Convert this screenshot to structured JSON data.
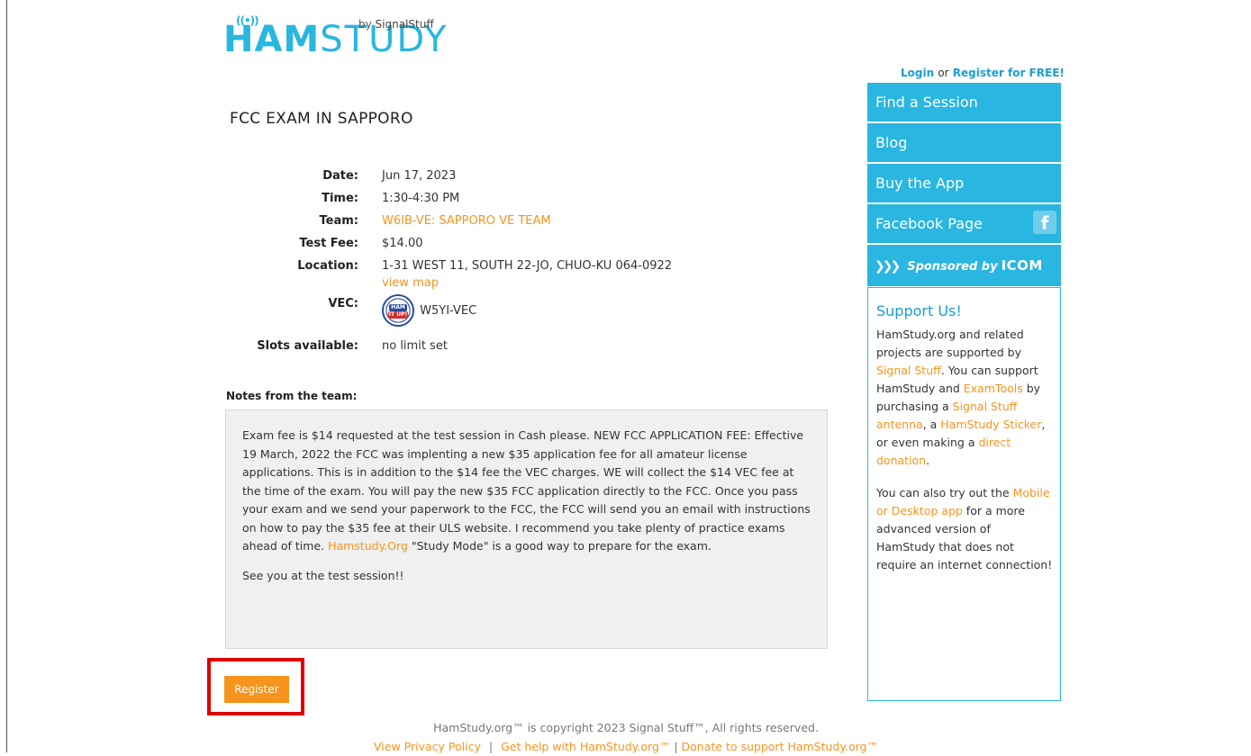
{
  "logo": {
    "ham": "HAM",
    "study": "STUDY",
    "waves": "((•))",
    "by": "by",
    "brand": "SignalStuff"
  },
  "title": "FCC EXAM IN SAPPORO",
  "details": {
    "date_label": "Date:",
    "date": "Jun 17, 2023",
    "time_label": "Time:",
    "time": "1:30-4:30 PM",
    "team_label": "Team:",
    "team": "W6IB-VE: SAPPORO VE TEAM",
    "fee_label": "Test Fee:",
    "fee": "$14.00",
    "location_label": "Location:",
    "location": "1-31 WEST 11, SOUTH 22-JO, CHUO-KU 064-0922",
    "view_map": "view map",
    "vec_label": "VEC:",
    "vec": "W5YI-VEC",
    "vec_logo_top": "HAM",
    "vec_logo_bottom": "IT UP!",
    "slots_label": "Slots available:",
    "slots": "no limit set"
  },
  "notes": {
    "label": "Notes from the team:",
    "p1_before": "Exam fee is $14 requested at the test session in Cash please. NEW FCC APPLICATION FEE: Effective 19 March, 2022 the FCC was implenting a new $35 application fee for all amateur license applications. This is in addition to the $14 fee the VEC charges. WE will collect the $14 VEC fee at the time of the exam. You will pay the new $35 FCC application directly to the FCC. Once you pass your exam and we send your paperwork to the FCC, the FCC will send you an email with instructions on how to pay the $35 fee at their ULS website. I recommend you take plenty of practice exams ahead of time. ",
    "p1_link": "Hamstudy.Org",
    "p1_after": " \"Study Mode\" is a good way to prepare for the exam.",
    "p2": "See you at the test session!!"
  },
  "register_label": "Register",
  "footer": {
    "copyright": "HamStudy.org™ is copyright 2023 Signal Stuff™, All rights reserved.",
    "privacy": "View Privacy Policy",
    "sep1": "|",
    "help": "Get help with HamStudy.org™",
    "sep2": "|",
    "donate": "Donate to support HamStudy.org™"
  },
  "auth": {
    "login": "Login",
    "or": "or",
    "register": "Register for FREE!"
  },
  "nav": {
    "find_session": "Find a Session",
    "blog": "Blog",
    "buy_app": "Buy the App",
    "facebook": "Facebook Page",
    "fb_glyph": "f",
    "sponsored_chev": "❯❯❯",
    "sponsored_by": "Sponsored by",
    "icom": "ICOM"
  },
  "support": {
    "heading": "Support Us!",
    "t1": "HamStudy.org and related projects are supported by ",
    "signal_stuff": "Signal Stuff",
    "t2": ". You can support HamStudy and ",
    "examtools": "ExamTools",
    "t3": " by purchasing a ",
    "antenna": "Signal Stuff antenna",
    "t4": ", a ",
    "sticker": "HamStudy Sticker",
    "t5": ", or even making a ",
    "donation": "direct donation",
    "t6": ".",
    "t7": "You can also try out the ",
    "mobile_app": "Mobile or Desktop app",
    "t8": " for a more advanced version of HamStudy that does not require an internet connection!"
  },
  "colors": {
    "accent": "#29b6e0",
    "link": "#f7941d",
    "highlight": "#e00000"
  }
}
